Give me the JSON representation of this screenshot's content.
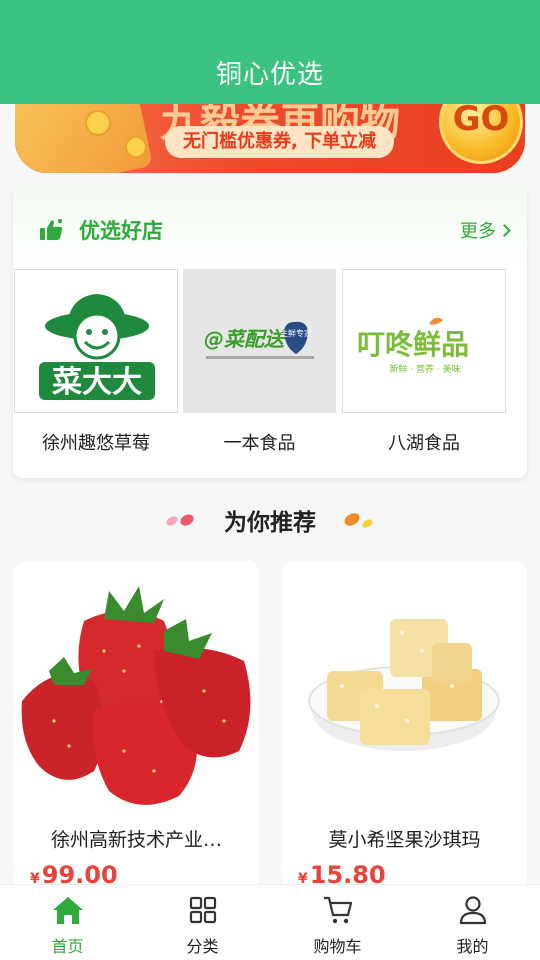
{
  "header": {
    "title": "铜心优选"
  },
  "banner": {
    "headline": "九毅券再购物",
    "subtitle": "无门槛优惠券, 下单立减",
    "go_label": "GO"
  },
  "shops_section": {
    "title": "优选好店",
    "more_label": "更多",
    "shops": [
      {
        "name": "徐州趣悠草莓",
        "logo_text": "菜大大"
      },
      {
        "name": "一本食品",
        "logo_text": "@菜配送",
        "logo_badge": "生鲜专家"
      },
      {
        "name": "八湖食品",
        "logo_text": "叮咚鲜品",
        "logo_sub": "新鲜 · 营养 · 美味"
      }
    ]
  },
  "recommend": {
    "title": "为你推荐"
  },
  "products": [
    {
      "name": "徐州高新技术产业…",
      "currency": "¥",
      "price": "99.00"
    },
    {
      "name": "莫小希坚果沙琪玛",
      "currency": "¥",
      "price": "15.80"
    }
  ],
  "tabbar": {
    "items": [
      {
        "label": "首页",
        "icon": "home-icon",
        "active": true
      },
      {
        "label": "分类",
        "icon": "grid-icon",
        "active": false
      },
      {
        "label": "购物车",
        "icon": "cart-icon",
        "active": false
      },
      {
        "label": "我的",
        "icon": "user-icon",
        "active": false
      }
    ]
  },
  "colors": {
    "brand": "#3bc180",
    "accent_green": "#2eab3b",
    "price_red": "#e8423b"
  }
}
